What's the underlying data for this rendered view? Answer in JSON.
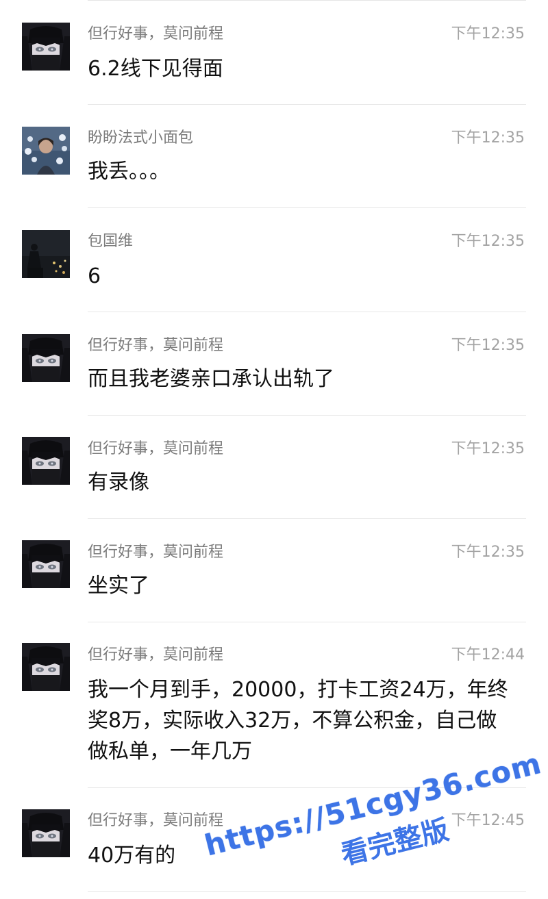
{
  "messages": [
    {
      "sender": "但行好事，莫问前程",
      "time": "下午12:35",
      "text": "6.2线下见得面",
      "avatar": "anime-girl-avatar"
    },
    {
      "sender": "盼盼法式小面包",
      "time": "下午12:35",
      "text": "我丢。。。",
      "avatar": "person-flowers-avatar"
    },
    {
      "sender": "包国维",
      "time": "下午12:35",
      "text": "6",
      "avatar": "night-city-avatar"
    },
    {
      "sender": "但行好事，莫问前程",
      "time": "下午12:35",
      "text": "而且我老婆亲口承认出轨了",
      "avatar": "anime-girl-avatar"
    },
    {
      "sender": "但行好事，莫问前程",
      "time": "下午12:35",
      "text": "有录像",
      "avatar": "anime-girl-avatar"
    },
    {
      "sender": "但行好事，莫问前程",
      "time": "下午12:35",
      "text": "坐实了",
      "avatar": "anime-girl-avatar"
    },
    {
      "sender": "但行好事，莫问前程",
      "time": "下午12:44",
      "text": "我一个月到手，20000，打卡工资24万，年终奖8万，实际收入32万，不算公积金，自己做做私单，一年几万",
      "avatar": "anime-girl-avatar"
    },
    {
      "sender": "但行好事，莫问前程",
      "time": "下午12:45",
      "text": "40万有的",
      "avatar": "anime-girl-avatar"
    }
  ],
  "watermark": {
    "url": "https://51cgy36.com",
    "subtitle": "看完整版",
    "color": "#3d74e6"
  }
}
